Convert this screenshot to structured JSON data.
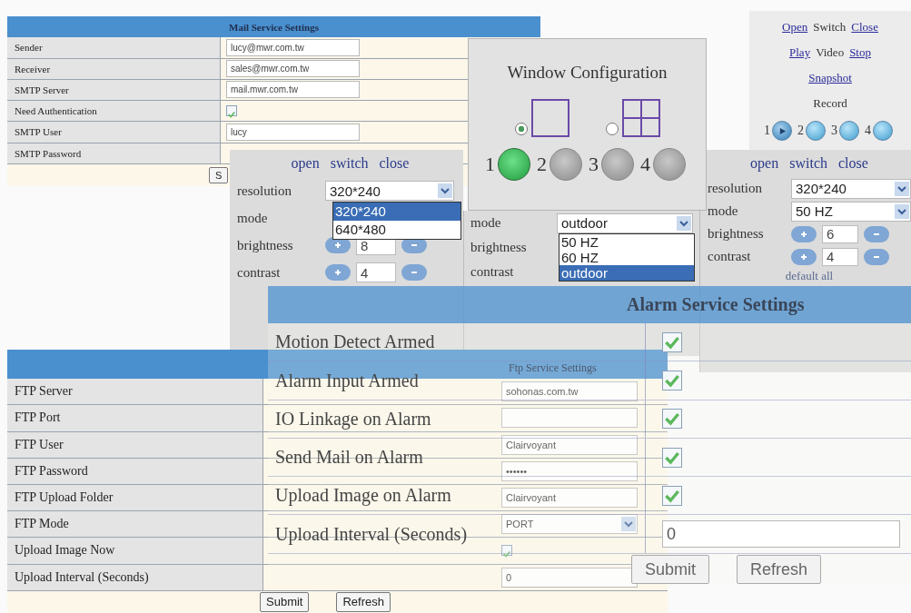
{
  "mail_panel": {
    "title": "Mail Service Settings",
    "rows": [
      {
        "label": "Sender",
        "kind": "text",
        "value": "lucy@mwr.com.tw"
      },
      {
        "label": "Receiver",
        "kind": "text",
        "value": "sales@mwr.com.tw"
      },
      {
        "label": "SMTP Server",
        "kind": "text",
        "value": "mail.mwr.com.tw"
      },
      {
        "label": "Need Authentication",
        "kind": "checkbox",
        "checked": true
      },
      {
        "label": "SMTP User",
        "kind": "text",
        "value": "lucy"
      },
      {
        "label": "SMTP Password"
      }
    ],
    "buttons": [
      "S"
    ]
  },
  "camera_panels": [
    {
      "links": [
        "open",
        "switch",
        "close"
      ],
      "rows": [
        {
          "kind": "select",
          "label": "resolution",
          "value": "320*240",
          "options": [
            {
              "text": "320*240",
              "selected": true
            },
            {
              "text": "640*480",
              "selected": false
            }
          ]
        },
        {
          "kind": "label",
          "label": "mode"
        },
        {
          "kind": "stepper",
          "label": "brightness",
          "value": "8"
        },
        {
          "kind": "stepper",
          "label": "contrast",
          "value": "4"
        }
      ]
    },
    {
      "rows": [
        {
          "kind": "select",
          "label": "mode",
          "value": "outdoor",
          "options": [
            {
              "text": "50 HZ",
              "selected": false
            },
            {
              "text": "60 HZ",
              "selected": false
            },
            {
              "text": "outdoor",
              "selected": true
            }
          ]
        },
        {
          "kind": "label",
          "label": "brightness"
        },
        {
          "kind": "label",
          "label": "contrast"
        }
      ]
    },
    {
      "links": [
        "open",
        "switch",
        "close"
      ],
      "rows": [
        {
          "kind": "select",
          "label": "resolution",
          "value": "320*240"
        },
        {
          "kind": "select",
          "label": "mode",
          "value": "50 HZ"
        },
        {
          "kind": "stepper",
          "label": "brightness",
          "value": "6"
        },
        {
          "kind": "stepper",
          "label": "contrast",
          "value": "4"
        }
      ],
      "default_link": "default all"
    }
  ],
  "window_config": {
    "title": "Window Configuration",
    "layouts": [
      {
        "kind": "single",
        "selected": true
      },
      {
        "kind": "quad",
        "selected": false
      }
    ],
    "channels": [
      {
        "label": "1",
        "active": true
      },
      {
        "label": "2",
        "active": false
      },
      {
        "label": "3",
        "active": false
      },
      {
        "label": "4",
        "active": false
      }
    ]
  },
  "video_controls": {
    "link_rows": [
      [
        {
          "text": "Open",
          "kind": "link"
        },
        {
          "text": "Switch",
          "kind": "text"
        },
        {
          "text": "Close",
          "kind": "link"
        }
      ],
      [
        {
          "text": "Play",
          "kind": "link"
        },
        {
          "text": "Video",
          "kind": "text"
        },
        {
          "text": "Stop",
          "kind": "link"
        }
      ],
      [
        {
          "text": "Snapshot",
          "kind": "link"
        }
      ]
    ],
    "record_label": "Record",
    "record_channels": [
      {
        "label": "1",
        "selected": true
      },
      {
        "label": "2",
        "selected": false
      },
      {
        "label": "3",
        "selected": false
      },
      {
        "label": "4",
        "selected": false
      }
    ]
  },
  "ftp_panel": {
    "title": "Ftp Service Settings",
    "rows": [
      {
        "label": "FTP Server",
        "kind": "text",
        "value": "sohonas.com.tw"
      },
      {
        "label": "FTP Port",
        "kind": "text"
      },
      {
        "label": "FTP User",
        "kind": "text",
        "value": "Clairvoyant"
      },
      {
        "label": "FTP Password",
        "kind": "text",
        "value": "••••••"
      },
      {
        "label": "FTP Upload Folder",
        "kind": "text",
        "value": "Clairvoyant"
      },
      {
        "label": "FTP Mode",
        "kind": "select",
        "value": "PORT"
      },
      {
        "label": "Upload Image Now",
        "kind": "checkbox",
        "checked": true
      },
      {
        "label": "Upload Interval (Seconds)",
        "kind": "text",
        "value": "0"
      }
    ],
    "buttons": [
      "Submit",
      "Refresh"
    ]
  },
  "alarm_panel": {
    "title": "Alarm Service Settings",
    "rows": [
      {
        "label": "Motion Detect Armed",
        "kind": "checkbox",
        "checked": true
      },
      {
        "label": "Alarm Input Armed",
        "kind": "checkbox",
        "checked": true
      },
      {
        "label": "IO Linkage on Alarm",
        "kind": "checkbox",
        "checked": true
      },
      {
        "label": "Send Mail on Alarm",
        "kind": "checkbox",
        "checked": true
      },
      {
        "label": "Upload Image on Alarm",
        "kind": "checkbox",
        "checked": true
      },
      {
        "label": "Upload Interval (Seconds)",
        "kind": "text",
        "value": "0"
      }
    ],
    "buttons": [
      "Submit",
      "Refresh"
    ]
  }
}
